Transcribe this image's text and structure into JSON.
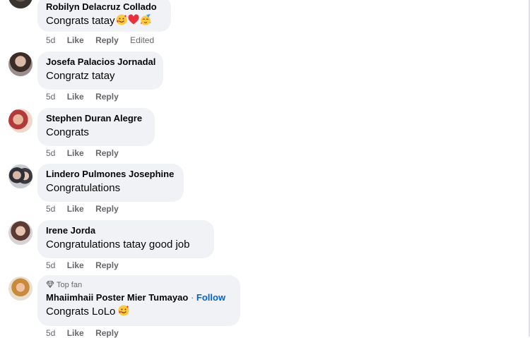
{
  "comments": [
    {
      "name": "Robilyn Delacruz Collado",
      "text": "Congrats tatay",
      "emojis": [
        "smiling-face-with-hearts",
        "red-heart",
        "partying-face"
      ],
      "time": "5d",
      "like": "Like",
      "reply": "Reply",
      "extra": "Edited"
    },
    {
      "name": "Josefa Palacios Jornadal",
      "text": "Congratz tatay",
      "time": "5d",
      "like": "Like",
      "reply": "Reply"
    },
    {
      "name": "Stephen Duran Alegre",
      "text": "Congrats",
      "time": "5d",
      "like": "Like",
      "reply": "Reply"
    },
    {
      "name": "Lindero Pulmones Josephine",
      "text": "Congratulations",
      "time": "5d",
      "like": "Like",
      "reply": "Reply"
    },
    {
      "name": "Irene Jorda",
      "text": "Congratulations tatay good job",
      "time": "5d",
      "like": "Like",
      "reply": "Reply"
    },
    {
      "badge": "Top fan",
      "name": "Mhaiimhaii Poster Mier Tumayao",
      "separator": "·",
      "follow": "Follow",
      "text": "Congrats LoLo",
      "emojis": [
        "smiling-face-with-hearts"
      ],
      "time": "5d",
      "like": "Like",
      "reply": "Reply"
    }
  ],
  "colors": {
    "bubble": "#f0f2f5",
    "meta": "#65676b",
    "link": "#0064d1"
  }
}
